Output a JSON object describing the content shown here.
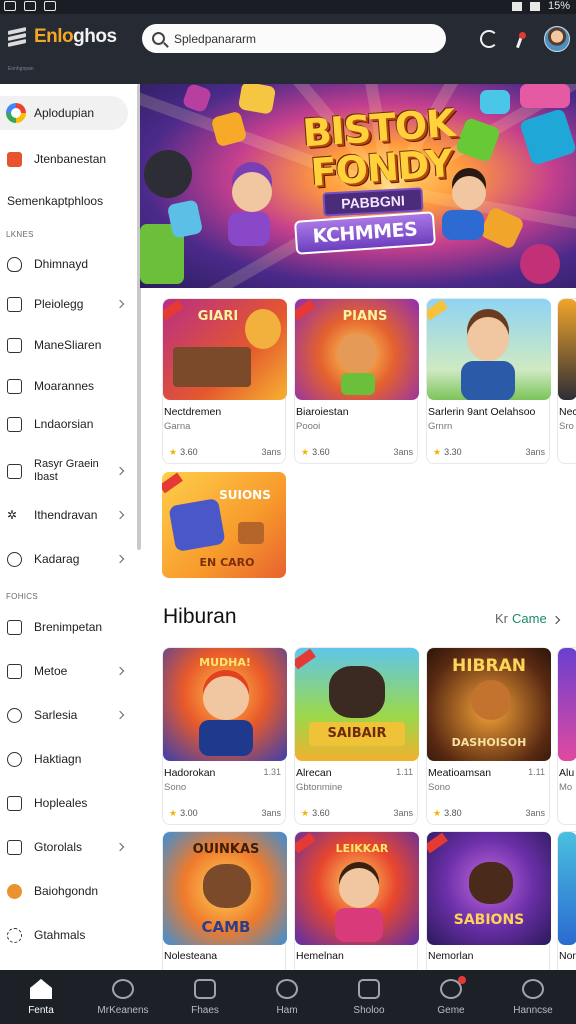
{
  "statusbar": {
    "battery": "15%"
  },
  "header": {
    "brand_accent": "Enlo",
    "brand_rest": "ghos",
    "brand_color": "#f5a623",
    "search_value": "Spledpanararm"
  },
  "sidebar": {
    "items": [
      {
        "label": "Aplodupian",
        "icon": "store-icon",
        "active": true
      },
      {
        "label": "Jtenbanestan",
        "icon": "games-icon"
      },
      {
        "label": "Semenkaptphloos",
        "icon": ""
      },
      {
        "label": "Dhimnayd",
        "icon": "shield-icon"
      },
      {
        "label": "Pleiolegg",
        "icon": "gamepad-icon"
      },
      {
        "label": "ManeSliaren",
        "icon": "list-icon"
      },
      {
        "label": "Moarannes",
        "icon": "book-icon"
      },
      {
        "label": "Lndaorsian",
        "icon": "doc-icon"
      },
      {
        "label": "Rasyr Graein Ibast",
        "icon": "grid-icon"
      },
      {
        "label": "Ithendravan",
        "icon": "star-icon"
      },
      {
        "label": "Kadarag",
        "icon": "search-icon"
      },
      {
        "label": "Brenimpetan",
        "icon": "puzzle-icon"
      },
      {
        "label": "Metoe",
        "icon": "music-icon"
      },
      {
        "label": "Sarlesia",
        "icon": "clock-icon"
      },
      {
        "label": "Haktiagn",
        "icon": "info-icon"
      },
      {
        "label": "Hopleales",
        "icon": "phone-icon"
      },
      {
        "label": "Gtorolals",
        "icon": "news-icon"
      },
      {
        "label": "Baiohgondn",
        "icon": "coin-icon"
      },
      {
        "label": "Gtahmals",
        "icon": "settings-icon"
      }
    ],
    "section1": "LKNES",
    "section2": "FOHICS"
  },
  "hero": {
    "title_line1": "BISTOK",
    "title_line2": "FONDY",
    "subtitle": "PABBGNI",
    "banner": "KCHMMES"
  },
  "row1": [
    {
      "title": "Nectdremen",
      "category": "Garna",
      "rating": "3.60",
      "size": "3ans",
      "thumb_text": "GIARI"
    },
    {
      "title": "Biaroiestan",
      "category": "Poooi",
      "rating": "3.60",
      "size": "3ans",
      "thumb_text": "PIANS"
    },
    {
      "title": "Sarlerin 9ant Oelahsoo",
      "category": "Grnrn",
      "rating": "3.30",
      "size": "3ans",
      "thumb_text": ""
    },
    {
      "title": "Nec",
      "category": "Sro",
      "rating": "",
      "size": "",
      "thumb_text": ""
    }
  ],
  "row1b": {
    "thumb_text": "SUIONS",
    "thumb_text2": "EN CARO"
  },
  "section": {
    "title": "Hiburan",
    "see_prefix": "Kr",
    "see_label": "Came"
  },
  "row2": [
    {
      "title": "Hadorokan",
      "category": "Sono",
      "rating": "3.00",
      "size": "3ans",
      "meta": "1.31",
      "thumb_text": "MUDHA!"
    },
    {
      "title": "Alrecan",
      "category": "Gbtonmine",
      "rating": "3.60",
      "size": "3ans",
      "meta": "1.11",
      "thumb_text": "SAIBAIR"
    },
    {
      "title": "Meatioamsan",
      "category": "Sono",
      "rating": "3.80",
      "size": "3ans",
      "meta": "1.11",
      "thumb_text": "HIBRAN"
    },
    {
      "title": "Alu",
      "category": "Mo",
      "rating": "",
      "size": "",
      "meta": "",
      "thumb_text": ""
    }
  ],
  "row3": [
    {
      "title": "Nolesteana",
      "thumb_text": "OUINKAS",
      "thumb_text2": "CAMB"
    },
    {
      "title": "Hemelnan",
      "thumb_text": "LEIKKAR"
    },
    {
      "title": "Nemorlan",
      "thumb_text": "SABIONS"
    },
    {
      "title": "Nor",
      "thumb_text": ""
    }
  ],
  "row2_sub": "DASHOISOH",
  "bottomnav": [
    {
      "label": "Fenta",
      "icon": "home-icon",
      "active": true
    },
    {
      "label": "MrKeanens",
      "icon": "games-icon"
    },
    {
      "label": "Fhaes",
      "icon": "apps-icon"
    },
    {
      "label": "Ham",
      "icon": "mic-icon"
    },
    {
      "label": "Sholoo",
      "icon": "box-icon"
    },
    {
      "label": "Geme",
      "icon": "gamepad-icon"
    },
    {
      "label": "Hanncse",
      "icon": "account-icon"
    }
  ]
}
